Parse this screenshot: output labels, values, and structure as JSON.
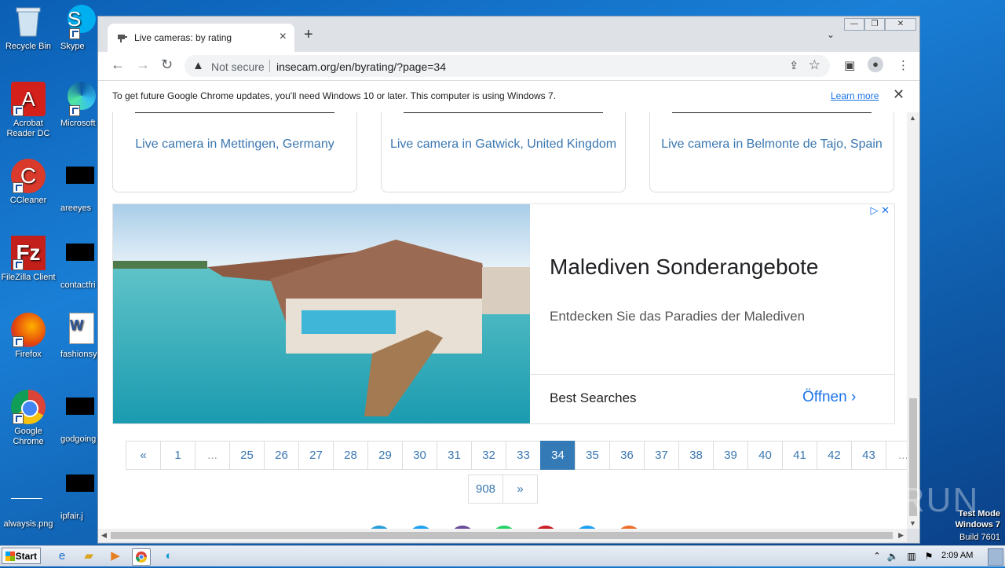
{
  "desktop": {
    "icons_left": [
      {
        "label": "Recycle Bin"
      },
      {
        "label": "Acrobat Reader DC"
      },
      {
        "label": "CCleaner"
      },
      {
        "label": "FileZilla Client"
      },
      {
        "label": "Firefox"
      },
      {
        "label": "Google Chrome"
      },
      {
        "label": "alwaysis.png"
      }
    ],
    "icons_right": [
      {
        "label": "Skype"
      },
      {
        "label": "Microsoft"
      },
      {
        "label": "areeyes"
      },
      {
        "label": "contactfri"
      },
      {
        "label": "fashionsy"
      },
      {
        "label": "godgoing"
      },
      {
        "label": "ipfair.j"
      }
    ]
  },
  "browser": {
    "tab_title": "Live cameras: by rating",
    "new_tab_label": "+",
    "address": {
      "security_label": "Not secure",
      "url": "insecam.org/en/byrating/?page=34"
    },
    "infobar": {
      "message": "To get future Google Chrome updates, you'll need Windows 10 or later. This computer is using Windows 7.",
      "link": "Learn more"
    }
  },
  "page": {
    "cards": [
      {
        "caption": "Live camera in Mettingen, Germany"
      },
      {
        "caption": "Live camera in Gatwick, United Kingdom"
      },
      {
        "caption": "Live camera in Belmonte de Tajo, Spain"
      }
    ],
    "ad": {
      "title": "Malediven Sonderangebote",
      "subtitle": "Entdecken Sie das Paradies der Malediven",
      "best_searches": "Best Searches",
      "open_label": "Öffnen",
      "choices": "▷ ✕"
    },
    "pagination": {
      "row1": [
        "«",
        "1",
        "...",
        "25",
        "26",
        "27",
        "28",
        "29",
        "30",
        "31",
        "32",
        "33",
        "34",
        "35",
        "36",
        "37",
        "38",
        "39",
        "40",
        "41",
        "42",
        "43",
        "..."
      ],
      "row2": [
        "908",
        "»"
      ],
      "active": "34"
    },
    "share_colors": [
      "#2a9fd8",
      "#1da1f2",
      "#6b4c9a",
      "#25d366",
      "#cb2027",
      "#1da1f2",
      "#ee6e2b"
    ]
  },
  "taskbar": {
    "start_label": "Start",
    "clock": "2:09 AM"
  },
  "watermark": {
    "brand": "ANY RUN",
    "line1": "Test Mode",
    "line2": "Windows 7",
    "line3": "Build 7601"
  }
}
